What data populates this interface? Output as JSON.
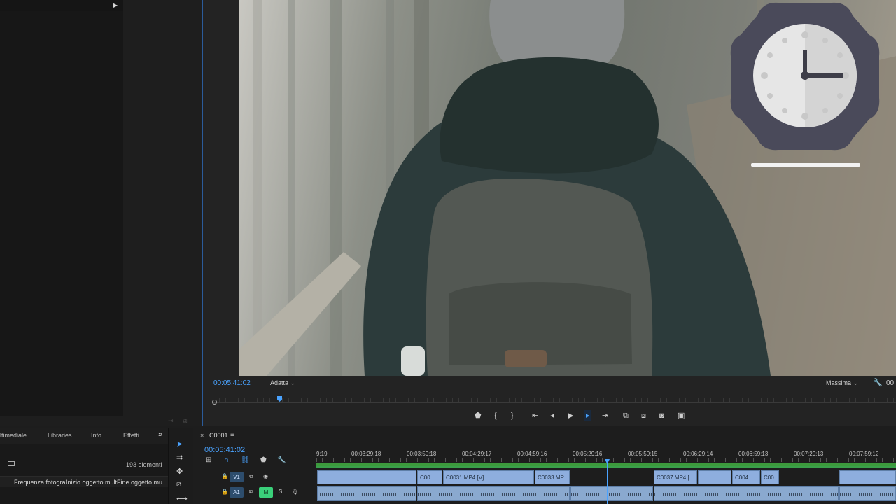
{
  "program_monitor": {
    "timecode": "00:05:41:02",
    "zoom": "Adatta",
    "quality": "Massima",
    "end_timecode": "00:"
  },
  "transport": {
    "marker": "⬟",
    "mark_in": "{",
    "mark_out": "}",
    "go_to_in": "⇤",
    "step_back": "◂",
    "play": "▶",
    "step_forward": "▸",
    "go_to_out": "⇥",
    "lift": "⧉",
    "extract": "⧈",
    "export_frame": "◙",
    "compare": "▣"
  },
  "project_panel": {
    "tabs": [
      "ltimediale",
      "Libraries",
      "Info",
      "Effetti"
    ],
    "overflow": "»",
    "item_count": "193 elementi",
    "columns": [
      "Frequenza fotogra",
      "Inizio oggetto mult",
      "Fine oggetto mu"
    ]
  },
  "timeline": {
    "sequence_name": "C0001",
    "timecode": "00:05:41:02",
    "ruler_labels": [
      "9:19",
      "00:03:29:18",
      "00:03:59:18",
      "00:04:29:17",
      "00:04:59:16",
      "00:05:29:16",
      "00:05:59:15",
      "00:06:29:14",
      "00:06:59:13",
      "00:07:29:13",
      "00:07:59:12"
    ],
    "tracks": {
      "v1": {
        "name": "V1",
        "source": "V1"
      },
      "a1": {
        "name": "A1",
        "mute": "M",
        "solo": "S"
      }
    },
    "video_clips": [
      "C00",
      "C0031.MP4 [V]",
      "C0033.MP",
      "C0037.MP4 [",
      "C004",
      "C00"
    ]
  },
  "icons": {
    "clock": "clock-icon",
    "wrench": "wrench-icon"
  },
  "colors": {
    "accent": "#4aa3ff",
    "clip_video": "#8eaede",
    "clip_audio": "#8aa9cf",
    "render_green": "#3aa04a",
    "clock_badge": "#4a4a5a"
  }
}
